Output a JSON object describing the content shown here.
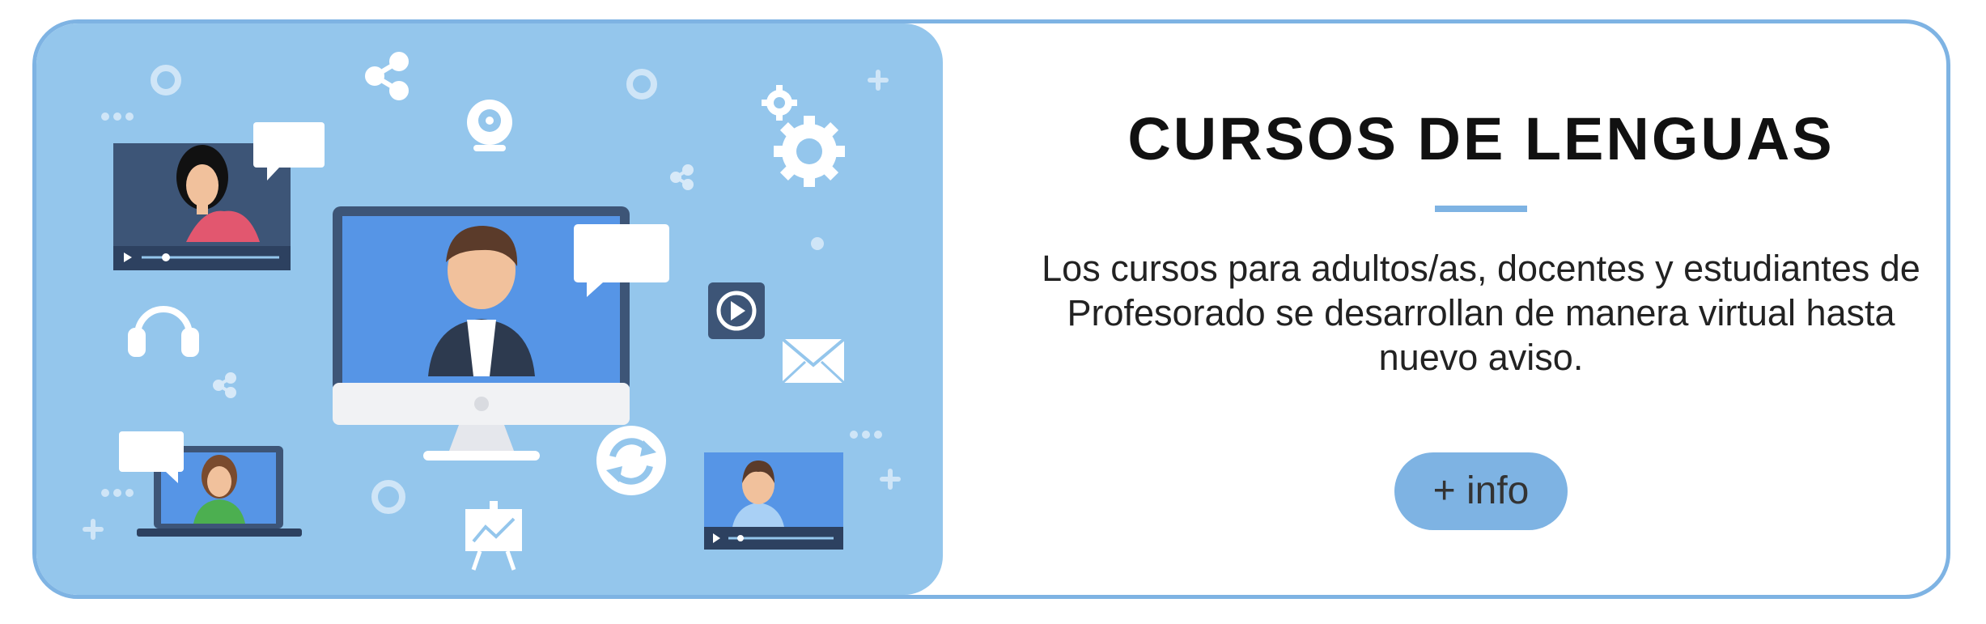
{
  "banner": {
    "title": "CURSOS DE LENGUAS",
    "description": "Los cursos para adultos/as, docentes y estudiantes de Profesorado se desarrollan de manera virtual hasta nuevo aviso.",
    "button_label": "+ info"
  },
  "colors": {
    "accent": "#7eb3e3",
    "illustration_bg": "#94c6ec",
    "screen_blue": "#5695e6",
    "dark_navy": "#3d5577"
  }
}
